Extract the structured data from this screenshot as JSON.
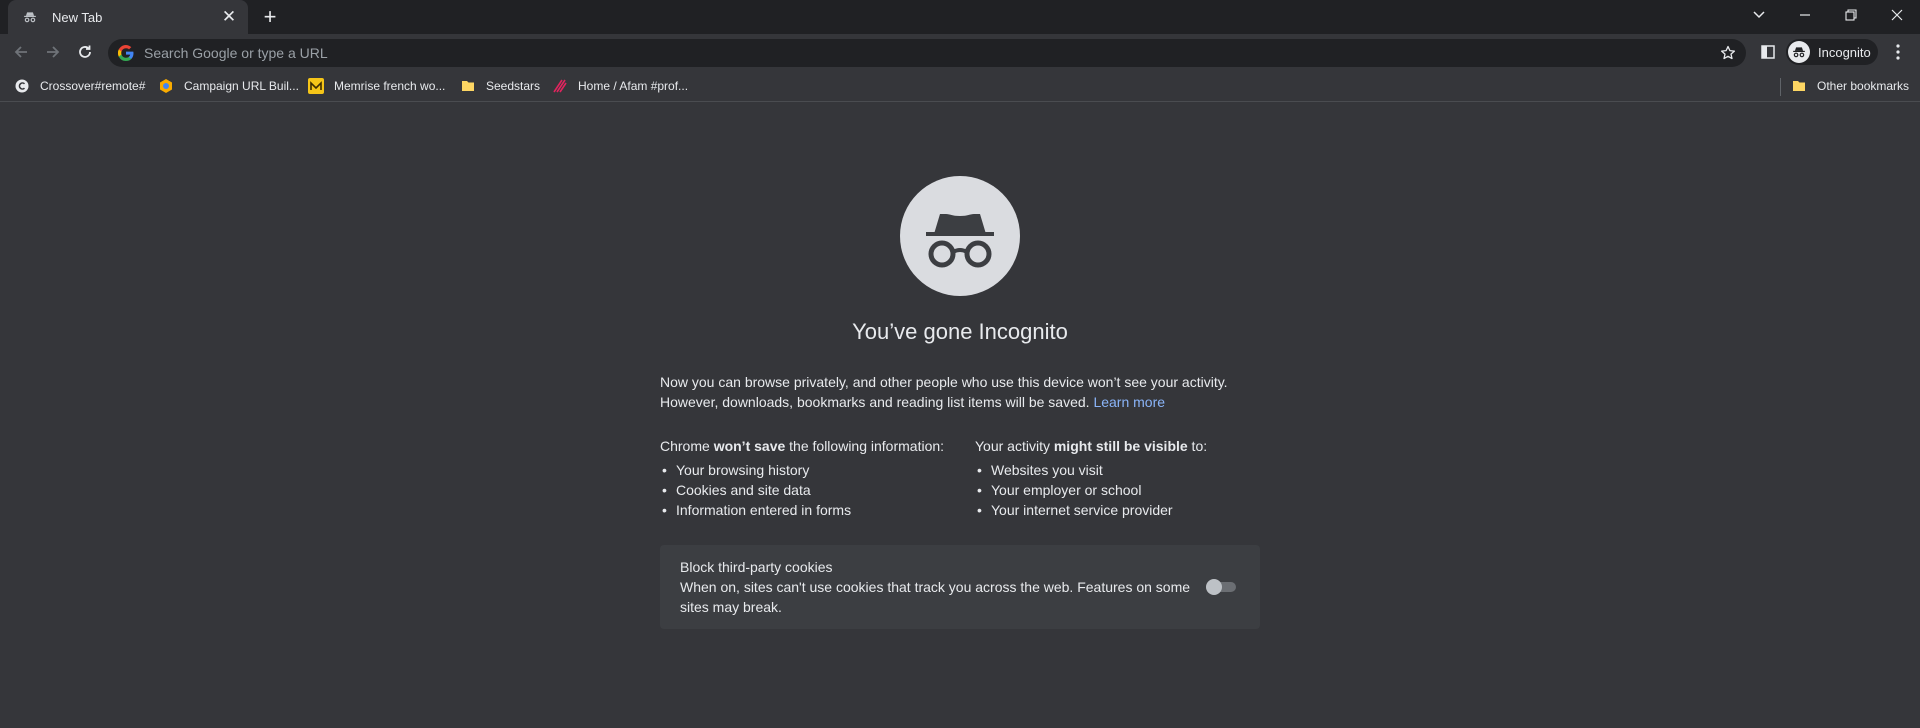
{
  "tab": {
    "title": "New Tab",
    "close_glyph": "✕"
  },
  "newtab_glyph": "+",
  "window_controls": {
    "dropdown": "⌄",
    "minimize": "—",
    "restore": "❐",
    "close": "✕"
  },
  "toolbar": {
    "back": "←",
    "forward": "→",
    "reload": "↻",
    "omnibox_placeholder": "Search Google or type a URL",
    "star": "☆",
    "profile_label": "Incognito",
    "menu": "⋮"
  },
  "bookmarks": [
    {
      "label": "Crossover#remote#",
      "icon": "crossover-icon",
      "color": "#e8eaed"
    },
    {
      "label": "Campaign URL Buil...",
      "icon": "campaign-url-builder-icon",
      "color": "#fbbc04"
    },
    {
      "label": "Memrise french wo...",
      "icon": "memrise-icon",
      "color": "#f5c518"
    },
    {
      "label": "Seedstars",
      "icon": "folder-icon",
      "color": "#fdd663"
    },
    {
      "label": "Home / Afam #prof...",
      "icon": "afam-icon",
      "color": "#e0245e"
    }
  ],
  "other_bookmarks": {
    "label": "Other bookmarks",
    "icon": "folder-icon"
  },
  "content": {
    "heading": "You’ve gone Incognito",
    "intro_text": "Now you can browse privately, and other people who use this device won’t see your activity. However, downloads, bookmarks and reading list items will be saved.",
    "learn_more": "Learn more",
    "wont_save": {
      "prefix": "Chrome ",
      "bold": "won’t save",
      "suffix": " the following information:",
      "items": [
        "Your browsing history",
        "Cookies and site data",
        "Information entered in forms"
      ]
    },
    "might_be_visible": {
      "prefix": "Your activity ",
      "bold": "might still be visible",
      "suffix": " to:",
      "items": [
        "Websites you visit",
        "Your employer or school",
        "Your internet service provider"
      ]
    },
    "cookies": {
      "title": "Block third-party cookies",
      "description": "When on, sites can't use cookies that track you across the web. Features on some sites may break.",
      "toggle_on": false
    }
  }
}
